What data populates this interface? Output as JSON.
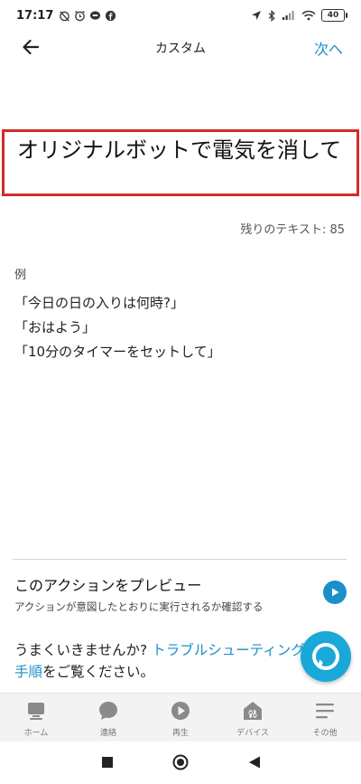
{
  "status_bar": {
    "time": "17:17",
    "battery": "40"
  },
  "app_bar": {
    "title": "カスタム",
    "next_label": "次へ"
  },
  "text_input": {
    "value": "オリジナルボットで電気を消して"
  },
  "remaining": {
    "label": "残りのテキスト: ",
    "count": "85"
  },
  "examples": {
    "label": "例",
    "items": [
      "「今日の日の入りは何時?」",
      "「おはよう」",
      "「10分のタイマーをセットして」"
    ]
  },
  "preview": {
    "title": "このアクションをプレビュー",
    "subtitle": "アクションが意図したとおりに実行されるか確認する"
  },
  "help": {
    "prefix": "うまくいきませんか? ",
    "link": "トラブルシューティング手順",
    "suffix": "をご覧ください。"
  },
  "bottom_nav": {
    "items": [
      {
        "label": "ホーム",
        "icon": "home-icon"
      },
      {
        "label": "連絡",
        "icon": "chat-icon"
      },
      {
        "label": "再生",
        "icon": "play-icon"
      },
      {
        "label": "デバイス",
        "icon": "devices-icon"
      },
      {
        "label": "その他",
        "icon": "menu-icon"
      }
    ]
  },
  "colors": {
    "accent": "#1a8fc9",
    "highlight_border": "#d42a2a",
    "alexa": "#1aa8d8"
  }
}
